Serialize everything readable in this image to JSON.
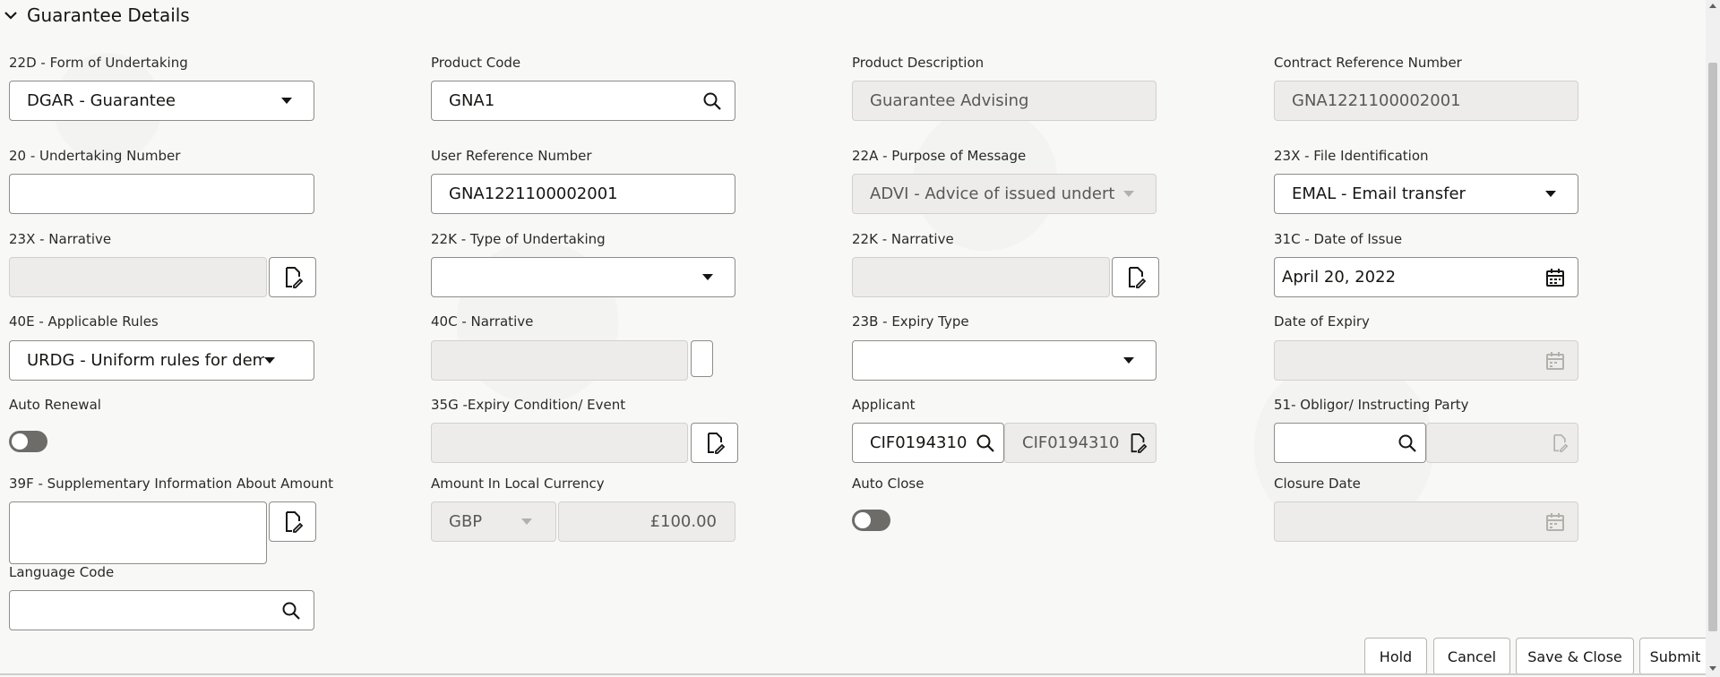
{
  "section": {
    "title": "Guarantee Details"
  },
  "fields": {
    "form_of_undertaking": {
      "label": "22D - Form of Undertaking",
      "value": "DGAR - Guarantee"
    },
    "product_code": {
      "label": "Product Code",
      "value": "GNA1"
    },
    "product_description": {
      "label": "Product Description",
      "value": "Guarantee Advising"
    },
    "contract_reference_number": {
      "label": "Contract Reference Number",
      "value": "GNA1221100002001"
    },
    "undertaking_number": {
      "label": "20 - Undertaking Number",
      "value": ""
    },
    "user_reference_number": {
      "label": "User Reference Number",
      "value": "GNA1221100002001"
    },
    "purpose_of_message": {
      "label": "22A - Purpose of Message",
      "value": "ADVI - Advice of issued undert"
    },
    "file_identification": {
      "label": "23X - File Identification",
      "value": "EMAL - Email transfer"
    },
    "narrative_23x": {
      "label": "23X - Narrative",
      "value": ""
    },
    "type_of_undertaking": {
      "label": "22K - Type of Undertaking",
      "value": ""
    },
    "narrative_22k": {
      "label": "22K - Narrative",
      "value": ""
    },
    "date_of_issue": {
      "label": "31C - Date of Issue",
      "value": "April 20, 2022"
    },
    "applicable_rules": {
      "label": "40E - Applicable Rules",
      "value": "URDG - Uniform rules for dema"
    },
    "narrative_40c": {
      "label": "40C - Narrative",
      "value": ""
    },
    "expiry_type": {
      "label": "23B - Expiry Type",
      "value": ""
    },
    "date_of_expiry": {
      "label": "Date of Expiry",
      "value": ""
    },
    "auto_renewal": {
      "label": "Auto Renewal",
      "state": "off"
    },
    "expiry_condition": {
      "label": "35G -Expiry Condition/ Event",
      "value": ""
    },
    "applicant": {
      "label": "Applicant",
      "value": "CIF0194310",
      "name_value": "CIF0194310"
    },
    "obligor": {
      "label": "51- Obligor/ Instructing Party",
      "value": ""
    },
    "supplementary_info": {
      "label": "39F - Supplementary Information About Amount",
      "value": ""
    },
    "amount_local_currency": {
      "label": "Amount In Local Currency",
      "currency": "GBP",
      "amount": "£100.00"
    },
    "auto_close": {
      "label": "Auto Close",
      "state": "off"
    },
    "closure_date": {
      "label": "Closure Date",
      "value": ""
    },
    "language_code": {
      "label": "Language Code",
      "value": ""
    }
  },
  "actions": {
    "hold": "Hold",
    "cancel": "Cancel",
    "save_close": "Save & Close",
    "submit": "Submit"
  },
  "icons": {
    "section_toggle": "chevron-down-icon",
    "search": "search-icon",
    "dropdown": "caret-down-icon",
    "edit": "edit-document-icon",
    "calendar": "calendar-icon"
  }
}
